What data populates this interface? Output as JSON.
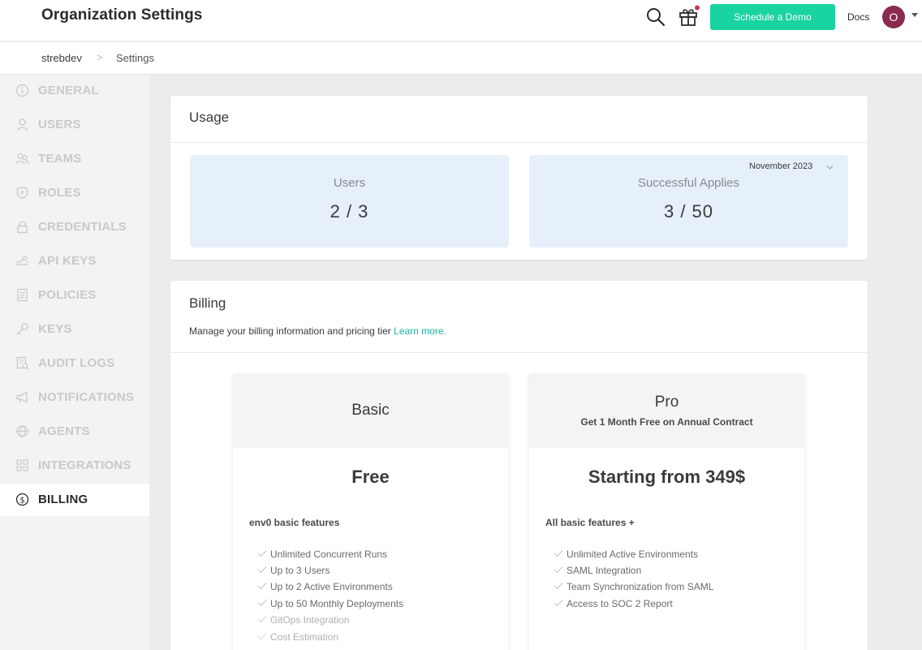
{
  "header": {
    "title": "Organization Settings",
    "demo_button": "Schedule a Demo",
    "docs_link": "Docs",
    "avatar_initial": "O",
    "accent_color": "#19d3a0",
    "notification_dot_color": "#c0394b"
  },
  "breadcrumb": {
    "org": "strebdev",
    "separator": ">",
    "page": "Settings"
  },
  "sidebar": {
    "items": [
      {
        "label": "GENERAL",
        "icon": "info-icon"
      },
      {
        "label": "USERS",
        "icon": "user-icon"
      },
      {
        "label": "TEAMS",
        "icon": "team-icon"
      },
      {
        "label": "ROLES",
        "icon": "shield-icon"
      },
      {
        "label": "CREDENTIALS",
        "icon": "lock-icon"
      },
      {
        "label": "API KEYS",
        "icon": "api-key-icon"
      },
      {
        "label": "POLICIES",
        "icon": "document-icon"
      },
      {
        "label": "KEYS",
        "icon": "key-icon"
      },
      {
        "label": "AUDIT LOGS",
        "icon": "audit-log-icon"
      },
      {
        "label": "NOTIFICATIONS",
        "icon": "megaphone-icon"
      },
      {
        "label": "AGENTS",
        "icon": "agent-icon"
      },
      {
        "label": "INTEGRATIONS",
        "icon": "grid-icon"
      },
      {
        "label": "BILLING",
        "icon": "dollar-icon",
        "active": true
      }
    ]
  },
  "usage": {
    "title": "Usage",
    "users": {
      "label": "Users",
      "value": "2 / 3"
    },
    "applies": {
      "label": "Successful Applies",
      "value": "3 / 50",
      "month": "November 2023"
    }
  },
  "billing": {
    "title": "Billing",
    "description": "Manage your billing information and pricing tier",
    "learn_more": "Learn more.",
    "plans": [
      {
        "name": "Basic",
        "subtitle": "",
        "price": "Free",
        "features_heading": "env0 basic features",
        "features": [
          "Unlimited Concurrent Runs",
          "Up to 3 Users",
          "Up to 2 Active Environments",
          "Up to 50 Monthly Deployments",
          "GitOps Integration",
          "Cost Estimation"
        ]
      },
      {
        "name": "Pro",
        "subtitle": "Get 1 Month Free on Annual Contract",
        "price": "Starting from 349$",
        "features_heading": "All basic features +",
        "features": [
          "Unlimited Active Environments",
          "SAML Integration",
          "Team Synchronization from SAML",
          "Access to SOC 2 Report"
        ]
      }
    ]
  }
}
